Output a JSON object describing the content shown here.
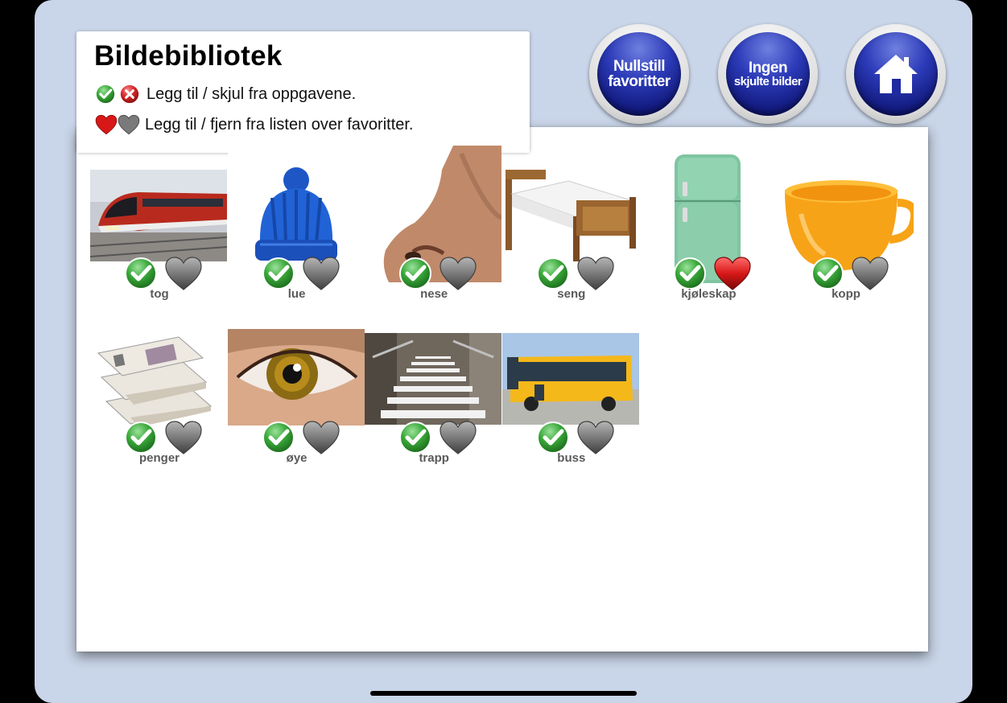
{
  "title": "Bildebibliotek",
  "legend": [
    {
      "text": "Legg til / skjul fra oppgavene."
    },
    {
      "text": "Legg til / fjern fra listen over favoritter."
    }
  ],
  "buttons": {
    "reset_favorites": {
      "line1": "Nullstill",
      "line2": "favoritter"
    },
    "no_hidden": {
      "line1": "Ingen",
      "line2": "skjulte bilder"
    },
    "home": {
      "icon": "home-icon"
    }
  },
  "images": [
    {
      "label": "tog",
      "icon": "train",
      "included": true,
      "favorite": false
    },
    {
      "label": "lue",
      "icon": "beanie",
      "included": true,
      "favorite": false
    },
    {
      "label": "nese",
      "icon": "nose",
      "included": true,
      "favorite": false
    },
    {
      "label": "seng",
      "icon": "bed",
      "included": true,
      "favorite": false
    },
    {
      "label": "kjøleskap",
      "icon": "fridge",
      "included": true,
      "favorite": true
    },
    {
      "label": "kopp",
      "icon": "cup",
      "included": true,
      "favorite": false
    },
    {
      "label": "penger",
      "icon": "money",
      "included": true,
      "favorite": false
    },
    {
      "label": "øye",
      "icon": "eye",
      "included": true,
      "favorite": false
    },
    {
      "label": "trapp",
      "icon": "stairs",
      "included": true,
      "favorite": false
    },
    {
      "label": "buss",
      "icon": "bus",
      "included": true,
      "favorite": false
    }
  ],
  "colors": {
    "background": "#c9d5e8",
    "check_green": "#3aa93a",
    "heart_red": "#d81818",
    "heart_gray": "#7a7a7a",
    "button_blue": "#1d2aa0"
  }
}
